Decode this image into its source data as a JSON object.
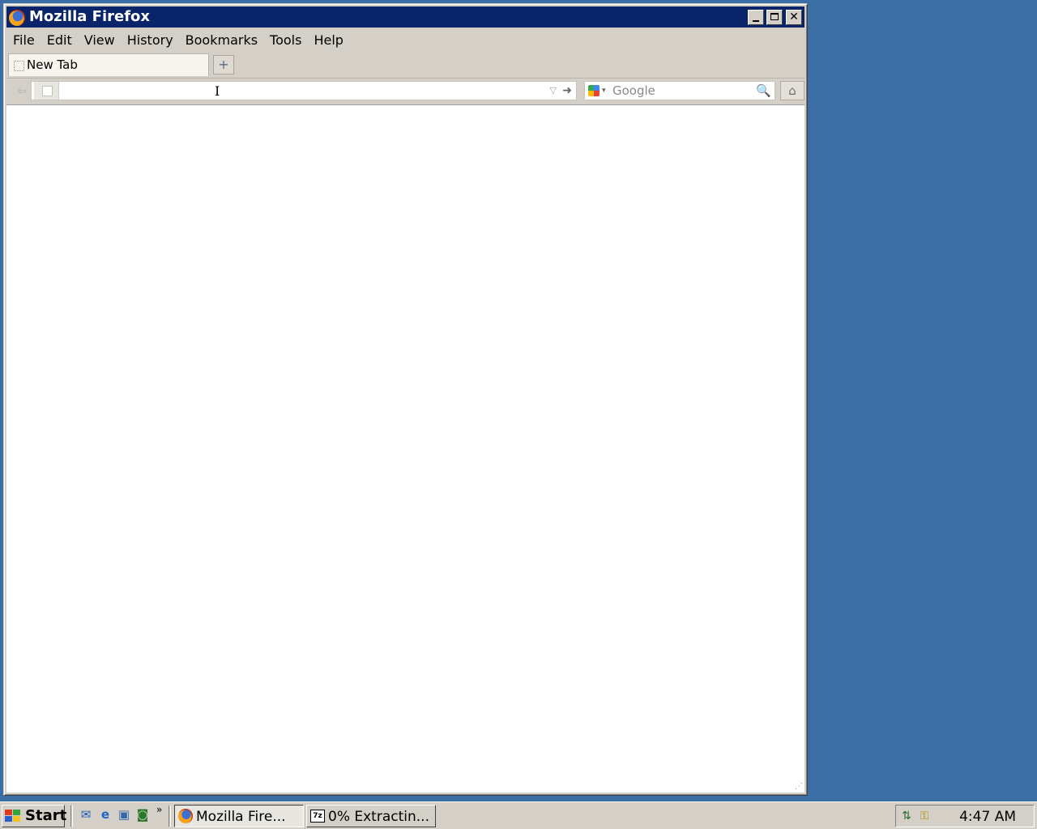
{
  "window": {
    "title": "Mozilla Firefox",
    "icon": "firefox-icon",
    "controls": [
      "minimize",
      "maximize",
      "close"
    ]
  },
  "menubar": {
    "items": [
      {
        "label": "File"
      },
      {
        "label": "Edit"
      },
      {
        "label": "View"
      },
      {
        "label": "History"
      },
      {
        "label": "Bookmarks"
      },
      {
        "label": "Tools"
      },
      {
        "label": "Help"
      }
    ]
  },
  "tabs": {
    "items": [
      {
        "label": "New Tab",
        "active": true
      }
    ],
    "new_tab_glyph": "+"
  },
  "navbar": {
    "back_glyph": "⇦",
    "url_value": "",
    "url_dropdown_glyph": "▽",
    "go_glyph": "➜",
    "search_placeholder": "Google",
    "search_engine_icon": "google-icon",
    "search_glyph": "🔍",
    "home_glyph": "⌂"
  },
  "taskbar": {
    "start_label": "Start",
    "quick_launch": [
      "outlook-icon",
      "internet-explorer-icon",
      "desktop-icon",
      "media-icon"
    ],
    "quick_launch_more": "»",
    "tasks": [
      {
        "label": "Mozilla Fire...",
        "icon": "firefox-icon",
        "active": true
      },
      {
        "label": "0% Extractin...",
        "icon": "7zip-icon",
        "active": false
      }
    ],
    "tray_icons": [
      "network-icon",
      "security-icon"
    ],
    "clock": "4:47 AM"
  },
  "colors": {
    "desktop": "#3a6ea5",
    "titlebar": "#0a246a",
    "chrome": "#d4d0c8"
  }
}
